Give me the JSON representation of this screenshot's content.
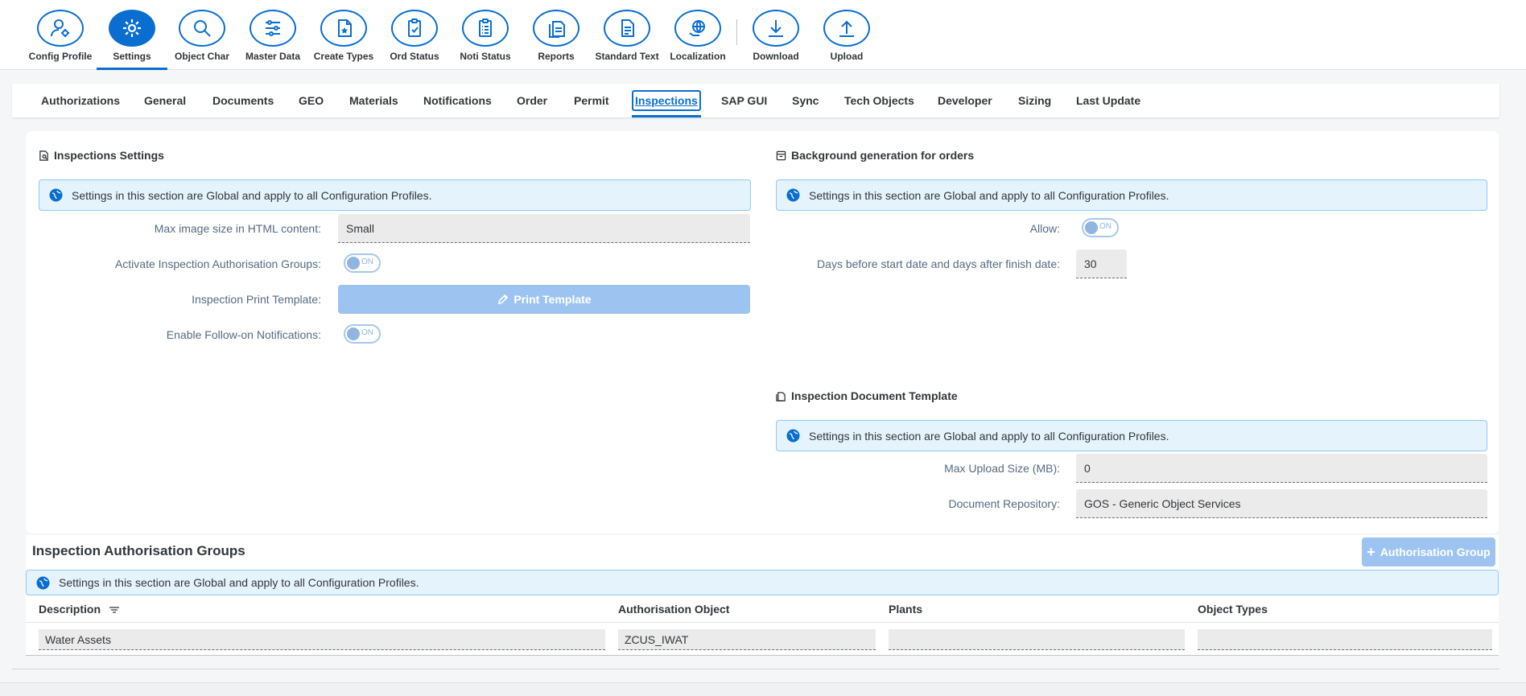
{
  "toolbar": {
    "items": [
      {
        "label": "Config Profile",
        "icon": "user-settings-icon"
      },
      {
        "label": "Settings",
        "icon": "gear-icon",
        "active": true
      },
      {
        "label": "Object Char",
        "icon": "search-icon"
      },
      {
        "label": "Master Data",
        "icon": "sliders-icon"
      },
      {
        "label": "Create Types",
        "icon": "document-star-icon"
      },
      {
        "label": "Ord Status",
        "icon": "clipboard-check-icon"
      },
      {
        "label": "Noti Status",
        "icon": "clipboard-list-icon"
      },
      {
        "label": "Reports",
        "icon": "documents-icon"
      },
      {
        "label": "Standard Text",
        "icon": "document-text-icon"
      },
      {
        "label": "Localization",
        "icon": "globe-hand-icon"
      },
      {
        "label": "Download",
        "icon": "download-icon"
      },
      {
        "label": "Upload",
        "icon": "upload-icon"
      }
    ]
  },
  "tabs": [
    "Authorizations",
    "General",
    "Documents",
    "GEO",
    "Materials",
    "Notifications",
    "Order",
    "Permit",
    "Inspections",
    "SAP GUI",
    "Sync",
    "Tech Objects",
    "Developer",
    "Sizing",
    "Last Update"
  ],
  "active_tab": "Inspections",
  "global_message": "Settings in this section are Global and apply to all Configuration Profiles.",
  "inspections_settings": {
    "title": "Inspections Settings",
    "max_image_label": "Max image size in HTML content:",
    "max_image_value": "Small",
    "activate_groups_label": "Activate Inspection Authorisation Groups:",
    "activate_groups_toggle": "ON",
    "print_template_label": "Inspection Print Template:",
    "print_template_button": "Print Template",
    "follow_on_label": "Enable Follow-on Notifications:",
    "follow_on_toggle": "ON"
  },
  "background_generation": {
    "title": "Background generation for orders",
    "allow_label": "Allow:",
    "allow_toggle": "ON",
    "days_label": "Days before start date and days after finish date:",
    "days_value": "30"
  },
  "document_template": {
    "title": "Inspection Document Template",
    "max_upload_label": "Max Upload Size (MB):",
    "max_upload_value": "0",
    "repository_label": "Document Repository:",
    "repository_value": "GOS - Generic Object Services"
  },
  "auth_groups": {
    "title": "Inspection Authorisation Groups",
    "add_button": "Authorisation Group",
    "columns": [
      "Description",
      "Authorisation Object",
      "Plants",
      "Object Types"
    ],
    "rows": [
      {
        "description": "Water Assets",
        "auth_object": "ZCUS_IWAT",
        "plants": "",
        "object_types": ""
      }
    ]
  },
  "colors": {
    "accent": "#0a6ed1",
    "message_bg": "#e5f3fd",
    "disabled_button": "#9dc4f1"
  }
}
